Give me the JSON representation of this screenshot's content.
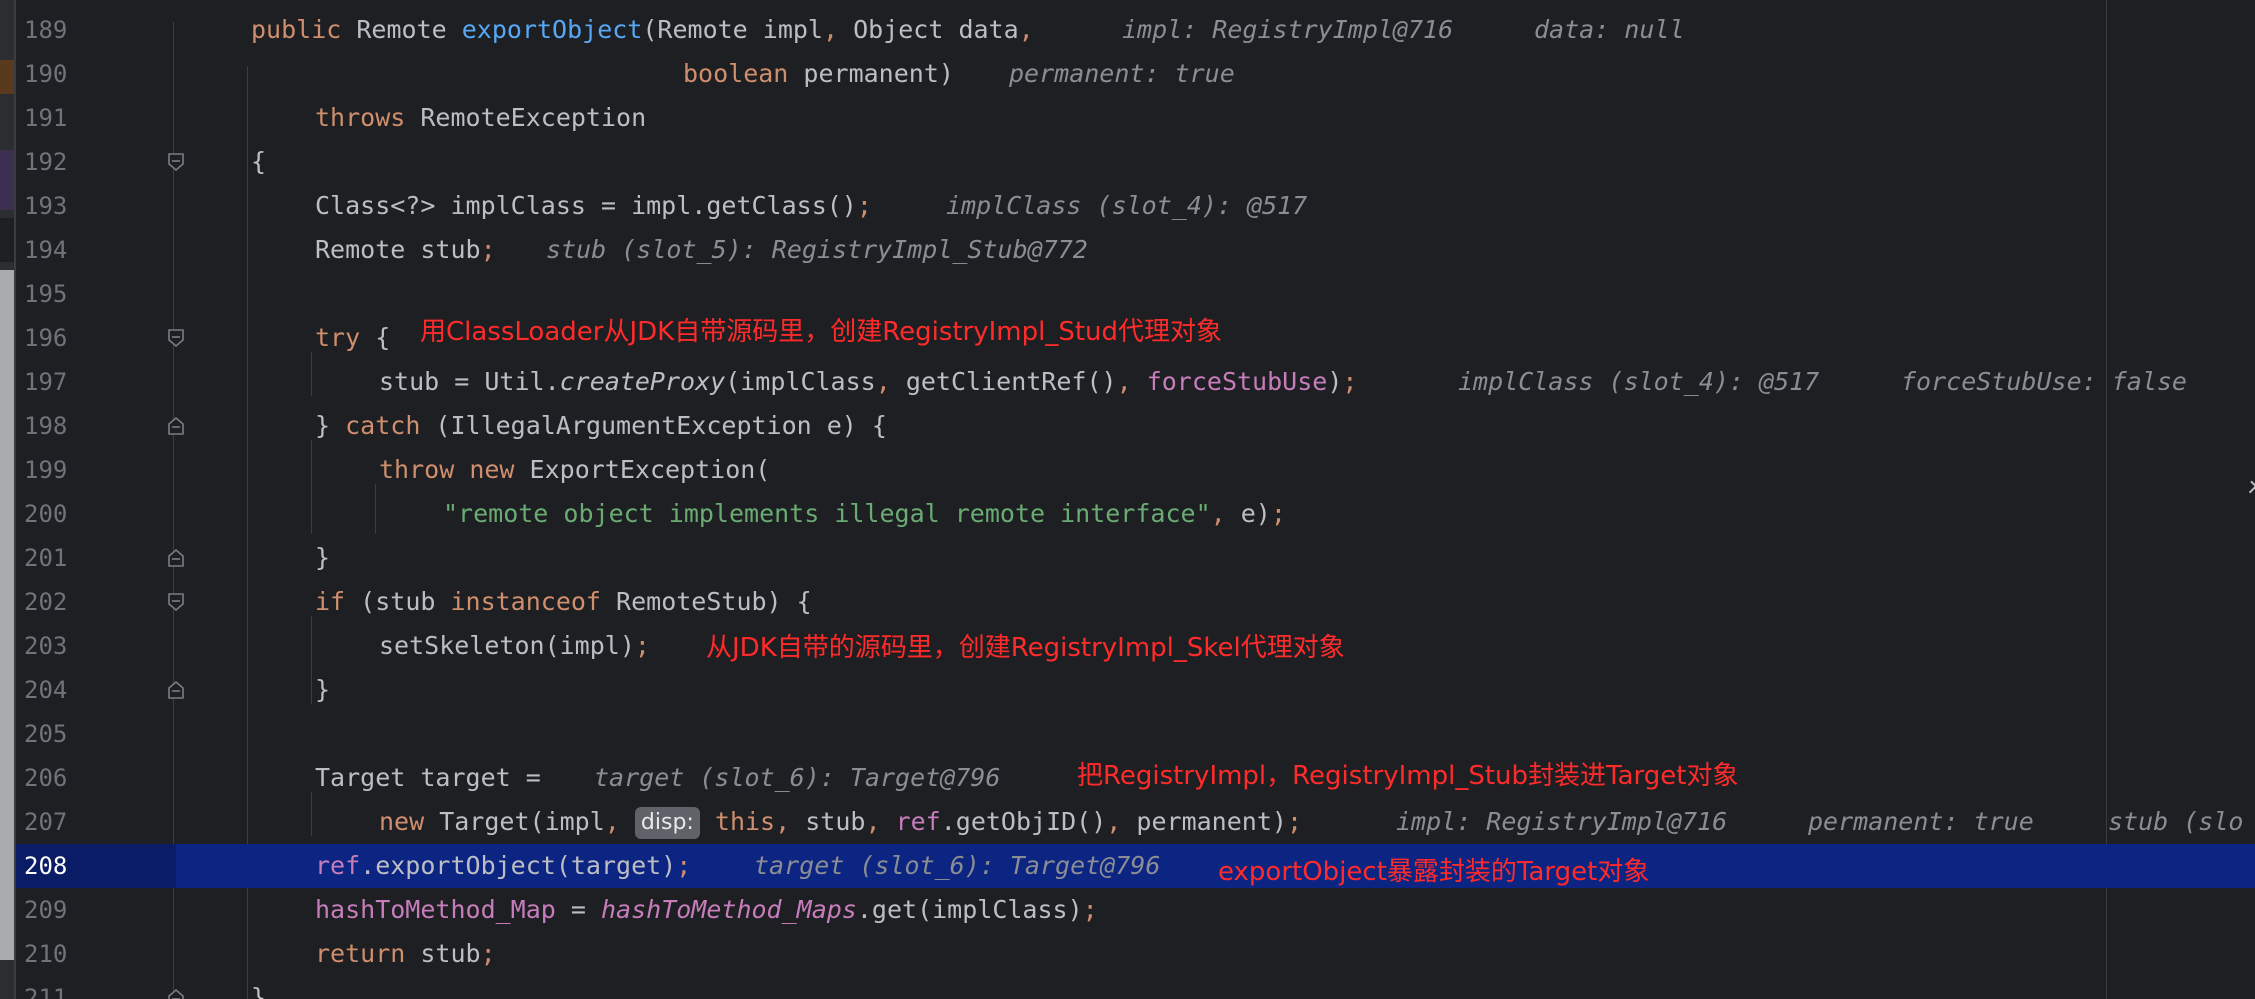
{
  "editor": {
    "current_line": "208",
    "colors": {
      "background": "#1e1f22",
      "current_line": "#0c2482",
      "keyword": "#cf8e6d",
      "method_decl": "#56a8f5",
      "field": "#c77dbb",
      "string": "#6aab73",
      "annotation": "#ff2b2b"
    }
  },
  "lines": {
    "l189": {
      "num": "189",
      "c1": "public",
      "c2": " Remote ",
      "c3": "exportObject",
      "c4": "(Remote impl",
      "c5": ",",
      "c6": " Object data",
      "c7": ",",
      "hint1": "impl: RegistryImpl@716",
      "hint2": "data: null"
    },
    "l190": {
      "num": "190",
      "c1": "boolean",
      "c2": " permanent)",
      "hint1": "permanent: true"
    },
    "l191": {
      "num": "191",
      "c1": "throws",
      "c2": " RemoteException"
    },
    "l192": {
      "num": "192",
      "c1": "{"
    },
    "l193": {
      "num": "193",
      "c1": "Class<?> implClass = impl.getClass()",
      "c2": ";",
      "hint1": "implClass (slot_4): @517"
    },
    "l194": {
      "num": "194",
      "c1": "Remote stub",
      "c2": ";",
      "hint1": "stub (slot_5): RegistryImpl_Stub@772"
    },
    "l195": {
      "num": "195"
    },
    "l196": {
      "num": "196",
      "c1": "try",
      "c2": " {"
    },
    "l197": {
      "num": "197",
      "c1": "stub = Util.",
      "c2": "createProxy",
      "c3": "(implClass",
      "c4": ",",
      "c5": " getClientRef()",
      "c6": ",",
      "c7": "forceStubUse",
      "c8": ")",
      "c9": ";",
      "hint1": "implClass (slot_4): @517",
      "hint2": "forceStubUse: false"
    },
    "l198": {
      "num": "198",
      "c1": "} ",
      "c2": "catch",
      "c3": " (IllegalArgumentException e) {"
    },
    "l199": {
      "num": "199",
      "c1": "throw",
      "c2": "new",
      "c3": " ExportException("
    },
    "l200": {
      "num": "200",
      "c1": "\"remote object implements illegal remote interface\"",
      "c2": ",",
      "c3": " e)",
      "c4": ";"
    },
    "l201": {
      "num": "201",
      "c1": "}"
    },
    "l202": {
      "num": "202",
      "c1": "if",
      "c2": " (stub ",
      "c3": "instanceof",
      "c4": " RemoteStub) {"
    },
    "l203": {
      "num": "203",
      "c1": "setSkeleton(impl)",
      "c2": ";"
    },
    "l204": {
      "num": "204",
      "c1": "}"
    },
    "l205": {
      "num": "205"
    },
    "l206": {
      "num": "206",
      "c1": "Target target =",
      "hint1": "target (slot_6): Target@796"
    },
    "l207": {
      "num": "207",
      "c1": "new",
      "c2": " Target(impl",
      "c3": ",",
      "badge": "disp:",
      "c4": "this",
      "c5": ",",
      "c6": " stub",
      "c7": ",",
      "c8": "ref",
      "c9": ".getObjID()",
      "c10": ",",
      "c11": " permanent)",
      "c12": ";",
      "hint1": "impl: RegistryImpl@716",
      "hint2": "permanent: true",
      "hint3": "stub (slo"
    },
    "l208": {
      "num": "208",
      "c1": "ref",
      "c2": ".exportObject(target)",
      "c3": ";",
      "hint1": "target (slot_6): Target@796"
    },
    "l209": {
      "num": "209",
      "c1": "hashToMethod_Map",
      "c2": " = ",
      "c3": "hashToMethod_Maps",
      "c4": ".get(implClass)",
      "c5": ";"
    },
    "l210": {
      "num": "210",
      "c1": "return",
      "c2": " stub",
      "c3": ";"
    },
    "l211": {
      "num": "211",
      "c1": "}"
    }
  },
  "annotations": {
    "a196": "用ClassLoader从JDK自带源码里，创建RegistryImpl_Stud代理对象",
    "a203": "从JDK自带的源码里，创建RegistryImpl_Skel代理对象",
    "a206": "把RegistryImpl，RegistryImpl_Stub封装进Target对象",
    "a208": "exportObject暴露封装的Target对象"
  },
  "icons": {
    "fold": "fold-marker-icon",
    "scroll": "chevron-right-icon"
  }
}
